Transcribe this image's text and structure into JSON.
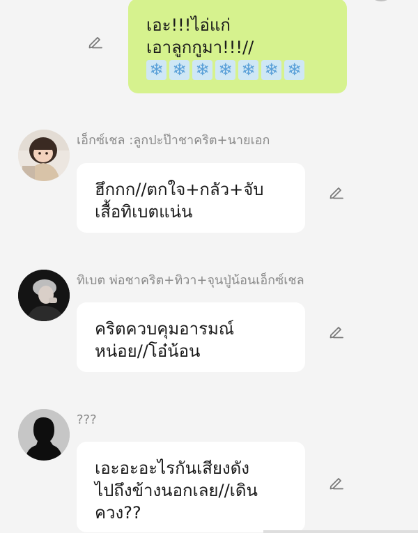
{
  "outgoing": {
    "lines": [
      "เอะ!!!ไอ่แก่",
      "เอาลูกกูมา!!!//"
    ],
    "emoji_row": [
      "❄",
      "❄",
      "❄",
      "❄",
      "❄",
      "❄",
      "❄"
    ]
  },
  "messages": [
    {
      "sender": "เอ็กซ์เชล :ลูกปะป๊าชาคริต+นายเอก",
      "lines": [
        "ฮึกกก//ตกใจ+กลัว+จับ",
        "เสื้อทิเบตแน่น"
      ]
    },
    {
      "sender": "ทิเบต พ่อชาคริต+ทิวา+จุนปู่น้อนเอ็กซ์เชล",
      "lines": [
        "คริตควบคุมอารมณ์",
        "หน่อย//โอ๋น้อน"
      ]
    },
    {
      "sender": "???",
      "lines": [
        "เอะอะอะไรกันเสียงดัง",
        "ไปถึงข้างนอกเลย//เดิน",
        "ควง??"
      ]
    }
  ],
  "icons": {
    "edit": "pencil-edit-icon",
    "snow": "snowflake-emoji"
  },
  "colors": {
    "background": "#f4f4f4",
    "outgoing_bubble": "#d6f28e",
    "incoming_bubble": "#ffffff",
    "sender_text": "#8a8a8a"
  }
}
